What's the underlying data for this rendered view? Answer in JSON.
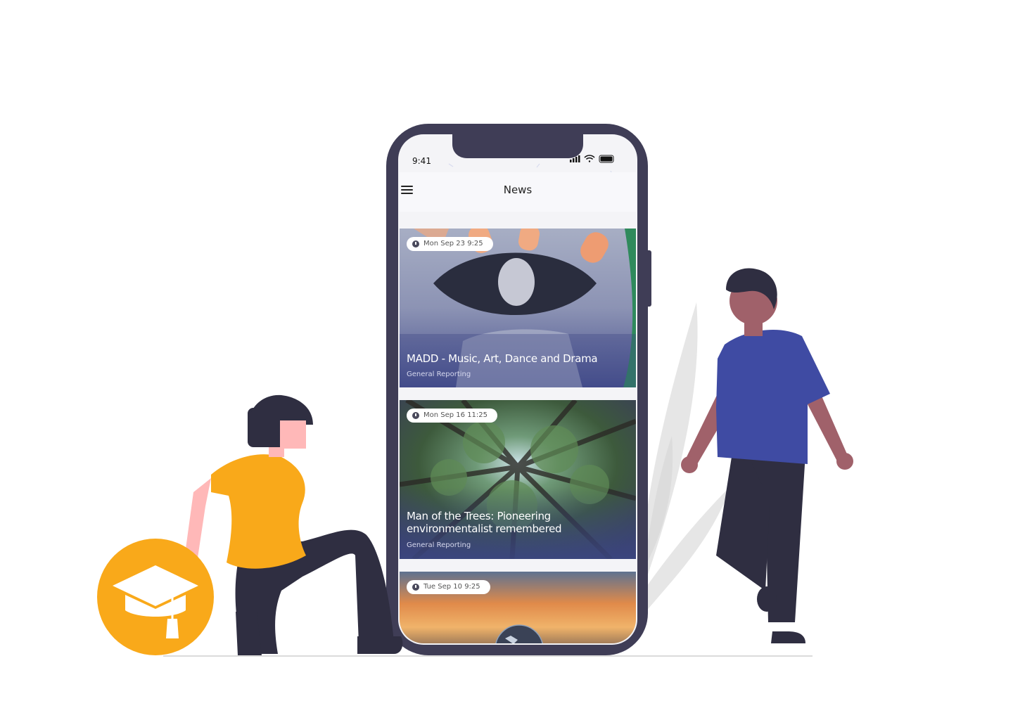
{
  "colors": {
    "phone_frame": "#3f3d56",
    "accent_yellow": "#f9a91a",
    "shirt_blue": "#3f4ba3",
    "skin_dark": "#a0616a",
    "skin_light": "#ffb8b8",
    "pants": "#2f2e41",
    "plant": "#e6e6e6"
  },
  "status_bar": {
    "time": "9:41",
    "icons": [
      "signal-icon",
      "wifi-icon",
      "battery-icon"
    ]
  },
  "app_bar": {
    "title": "News",
    "menu_icon": "hamburger-menu-icon"
  },
  "news": [
    {
      "date": "Mon Sep 23 9:25",
      "title": "MADD - Music, Art, Dance and Drama",
      "category": "General Reporting"
    },
    {
      "date": "Mon Sep 16 11:25",
      "title": "Man of the Trees: Pioneering environmentalist remembered",
      "category": "General Reporting"
    },
    {
      "date": "Tue Sep 10 9:25"
    }
  ],
  "badge_icon": "graduation-cap-icon"
}
